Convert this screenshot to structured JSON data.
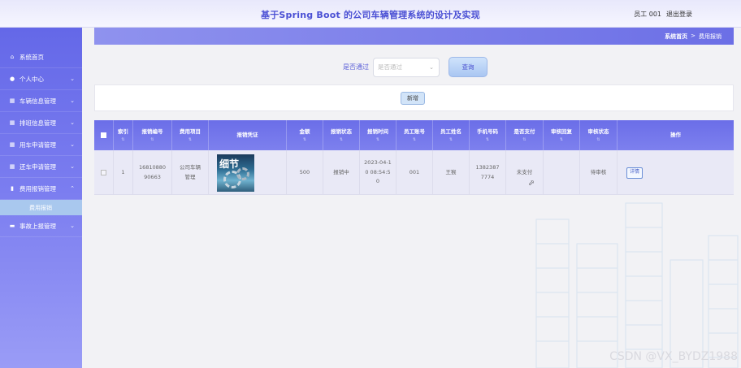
{
  "header": {
    "title": "基于Spring Boot 的公司车辆管理系统的设计及实现",
    "user_label": "员工 001",
    "logout_label": "退出登录"
  },
  "sidebar": {
    "items": [
      {
        "label": "系统首页",
        "icon": "home-icon"
      },
      {
        "label": "个人中心",
        "icon": "user-icon"
      },
      {
        "label": "车辆信息管理",
        "icon": "table-icon"
      },
      {
        "label": "排班信息管理",
        "icon": "table-icon"
      },
      {
        "label": "用车申请管理",
        "icon": "table-icon"
      },
      {
        "label": "还车申请管理",
        "icon": "table-icon"
      },
      {
        "label": "费用报销管理",
        "icon": "chart-icon"
      },
      {
        "label": "事故上报管理",
        "icon": "card-icon"
      }
    ],
    "submenu_active": "费用报销"
  },
  "breadcrumb": {
    "home": "系统首页",
    "separator": ">",
    "current": "费用报销"
  },
  "search": {
    "label": "是否通过",
    "placeholder": "是否通过",
    "button": "查询"
  },
  "toolbar": {
    "add_label": "新增"
  },
  "table": {
    "headers": [
      "索引",
      "报销编号",
      "费用项目",
      "报销凭证",
      "金额",
      "报销状态",
      "报销时间",
      "员工账号",
      "员工姓名",
      "手机号码",
      "是否支付",
      "审核回复",
      "审核状态",
      "操作"
    ],
    "rows": [
      {
        "index": "1",
        "number": "1681088090663",
        "item": "公司车辆管理",
        "voucher_text": "细节",
        "amount": "500",
        "status": "报销中",
        "time": "2023-04-10 08:54:50",
        "account": "001",
        "name": "王猴",
        "phone": "13823877774",
        "paid": "未支付",
        "reply": "",
        "audit": "待审核",
        "action": "详情"
      }
    ]
  },
  "watermark": "CSDN @VX_BYDZ1988"
}
